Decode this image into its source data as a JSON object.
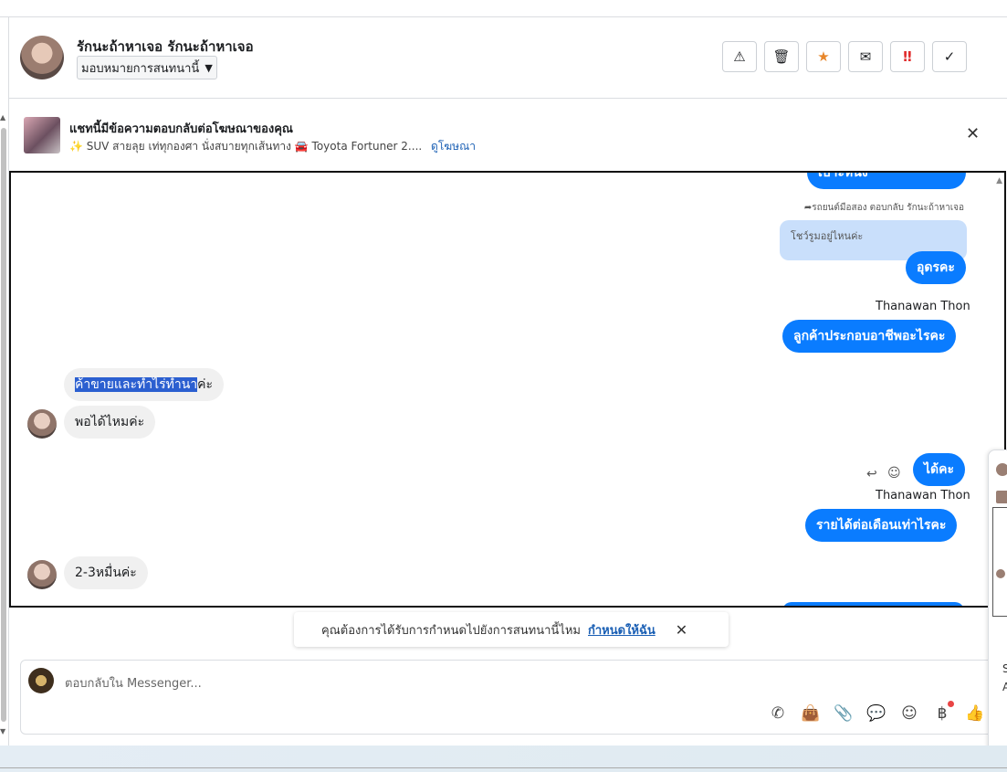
{
  "header": {
    "contact_name": "รักนะถ้าหาเจอ รักนะถ้าหาเจอ",
    "assign_label": "มอบหมายการสนทนานี้",
    "actions": [
      "spam-icon",
      "trash-icon",
      "star-icon",
      "mark-unread-icon",
      "urgent-icon",
      "done-icon"
    ]
  },
  "ad": {
    "title": "แชทนี้มีข้อความตอบกลับต่อโฆษณาของคุณ",
    "subtitle": "✨ SUV สายลุย เท่ทุกองศา นั่งสบายทุกเส้นทาง 🚘 Toyota Fortuner 2....",
    "link": "ดูโฆษณา"
  },
  "chat": {
    "top_partial": "เบาะหนัง",
    "reply_meta": "รถยนต์มือสอง ตอบกลับ รักนะถ้าหาเจอ",
    "quoted": "โชว์รูมอยู่ไหนค่ะ",
    "m1": "อุดรคะ",
    "sender1": "Thanawan Thon",
    "m2": "ลูกค้าประกอบอาชีพอะไรคะ",
    "m3_selected": "ค้าขายและทำไร่ทำนา",
    "m3_tail": "ค่ะ",
    "m4": "พอได้ไหมค่ะ",
    "m5": "ได้คะ",
    "sender2": "Thanawan Thon",
    "m6": "รายได้ต่อเดือนเท่าไรคะ",
    "m7": "2-3หมื่นค่ะ"
  },
  "toast": {
    "text": "คุณต้องการได้รับการกำหนดไปยังการสนทนานี้ไหม",
    "link": "กำหนดให้ฉัน"
  },
  "composer": {
    "placeholder": "ตอบกลับใน Messenger...",
    "tools": [
      "call-icon",
      "bag-icon",
      "attach-icon",
      "saved-reply-icon",
      "emoji-icon",
      "baht-icon",
      "like-icon"
    ]
  },
  "rightpop": {
    "t1": "S",
    "t2": "A"
  }
}
